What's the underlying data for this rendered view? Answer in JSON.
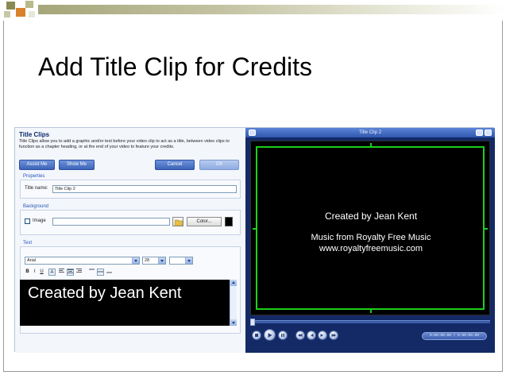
{
  "slide": {
    "title": "Add Title Clip for Credits",
    "header_colors": {
      "square_dark": "#8a8a55",
      "square_orange": "#d9822b",
      "square_light": "#b9b98a",
      "bar_start": "#a6a67a"
    }
  },
  "title_clips_panel": {
    "heading": "Title Clips",
    "description": "Title Clips allow you to add a graphic and/or text before your video clip to act as a title, between video clips to function as a chapter heading, or at the end of your video to feature your credits.",
    "buttons": {
      "assist_me": "Assist Me",
      "show_me": "Show Me",
      "cancel": "Cancel",
      "ok": "OK"
    },
    "properties": {
      "group_label": "Properties",
      "title_name_label": "Title name:",
      "title_name_value": "Title Clip 2"
    },
    "background": {
      "group_label": "Background",
      "image_label": "Image",
      "image_checked": false,
      "image_path": "",
      "color_button": "Color...",
      "color_value": "#000000"
    },
    "text": {
      "group_label": "Text",
      "font": "Arial",
      "size": "28",
      "toolbar": {
        "bold": "B",
        "italic": "I",
        "underline": "U",
        "a_button": "A"
      },
      "editor_content": "Created by Jean Kent"
    }
  },
  "preview_panel": {
    "window_title": "Title Clip 2",
    "lines": [
      "Created by Jean Kent",
      "Music from Royalty Free Music",
      "www.royaltyfreemusic.com"
    ],
    "timecode": "0:00:00.00 / 0:00:06.00",
    "accent_colors": {
      "safe_area_guide": "#1bcf1b",
      "panel_bg": "#132a66"
    }
  }
}
